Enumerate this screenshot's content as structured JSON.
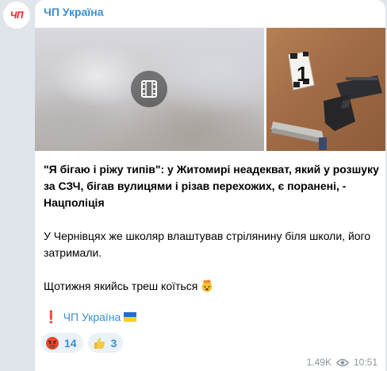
{
  "channel": {
    "avatar_text": "ЧП",
    "name": "ЧП Україна"
  },
  "media": {
    "video_icon": "film-icon",
    "photo_marker_number": "1"
  },
  "post": {
    "title": "\"Я бігаю і ріжу типів\": у Житомирі неадекват, який у розшуку за СЗЧ, бігав вулицями і різав перехожих, є поранені, - Нацполіція",
    "paragraph_2": "У Чернівцях же школяр влаштував стрілянину біля школи, його затримали.",
    "paragraph_3": "Щотижня якийсь треш коїться",
    "paragraph_3_emoji": "exploding-head-emoji"
  },
  "footer": {
    "exclamation": "❗",
    "channel_link": "ЧП Україна",
    "flag": "ukraine-flag"
  },
  "reactions": [
    {
      "emoji": "angry-face-emoji",
      "count": "14"
    },
    {
      "emoji": "thumbs-up-emoji",
      "count": "3"
    }
  ],
  "meta": {
    "views": "1.49K",
    "views_icon": "eye-icon",
    "time": "10:51"
  },
  "colors": {
    "accent": "#3a8fd0",
    "background": "#dfe5ea",
    "brand_red": "#e52222"
  }
}
